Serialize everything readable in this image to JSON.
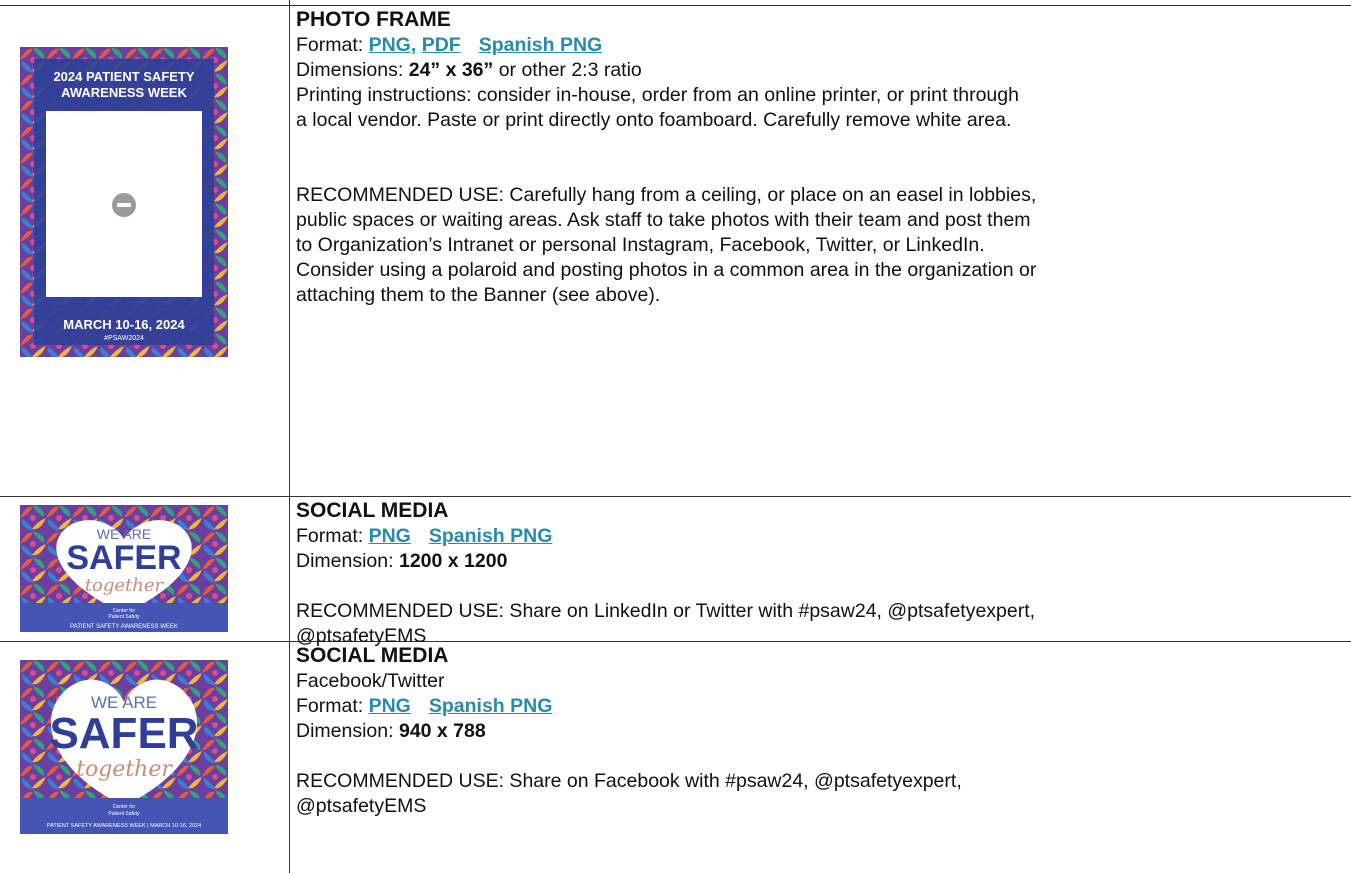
{
  "colors": {
    "link": "#2a8aa9",
    "navy": "#2f3f97",
    "banner": "#4455b5"
  },
  "rows": [
    {
      "title": "PHOTO FRAME",
      "format_label": "Format: ",
      "links": [
        "PNG,",
        "PDF",
        "Spanish PNG"
      ],
      "dim_label": "Dimensions: ",
      "dim_value": "24” x 36”",
      "dim_suffix": " or other 2:3 ratio",
      "print_line1": "Printing instructions: consider in-house, order from an online printer, or print through",
      "print_line2": "a local vendor. Paste or print directly onto foamboard. Carefully remove white area.",
      "use_lines": [
        "RECOMMENDED USE:  Carefully hang from a ceiling, or place on an easel in lobbies,",
        "public spaces or waiting areas. Ask staff to take photos with their team and post them",
        "to Organization’s Intranet or personal Instagram, Facebook, Twitter, or LinkedIn.",
        "Consider using a polaroid and posting photos in a common area in the organization or",
        "attaching them to the Banner (see above)."
      ],
      "thumb": {
        "heading_line1": "2024 PATIENT SAFETY",
        "heading_line2": "AWARENESS WEEK",
        "dates": "MARCH 10-16, 2024",
        "hashtag": "#PSAW2024",
        "icon": "minus-circle-icon"
      }
    },
    {
      "title": "SOCIAL MEDIA",
      "format_label": "Format: ",
      "links": [
        "PNG",
        "Spanish PNG"
      ],
      "dim_label": "Dimension: ",
      "dim_value": "1200 x 1200",
      "use_lines": [
        "RECOMMENDED USE:  Share on LinkedIn or Twitter with #psaw24, @ptsafetyexpert,",
        "@ptsafetyEMS"
      ],
      "thumb": {
        "we_are": "WE ARE",
        "safer": "SAFER",
        "together": "together",
        "logo_line1": "Center for",
        "logo_line2": "Patient Safety",
        "footer": "PATIENT SAFETY AWARENESS WEEK"
      }
    },
    {
      "title": "SOCIAL MEDIA",
      "subtitle": "Facebook/Twitter",
      "format_label": "Format: ",
      "links": [
        "PNG",
        "Spanish PNG"
      ],
      "dim_label": "Dimension: ",
      "dim_value": "940 x 788",
      "use_lines": [
        "RECOMMENDED USE:  Share on Facebook with #psaw24, @ptsafetyexpert,",
        "@ptsafetyEMS"
      ],
      "thumb": {
        "we_are": "WE ARE",
        "safer": "SAFER",
        "together": "together",
        "logo_line1": "Center for",
        "logo_line2": "Patient Safety",
        "footer": "PATIENT SAFETY AWARENESS WEEK  |  MARCH 10-16, 2024"
      }
    }
  ]
}
